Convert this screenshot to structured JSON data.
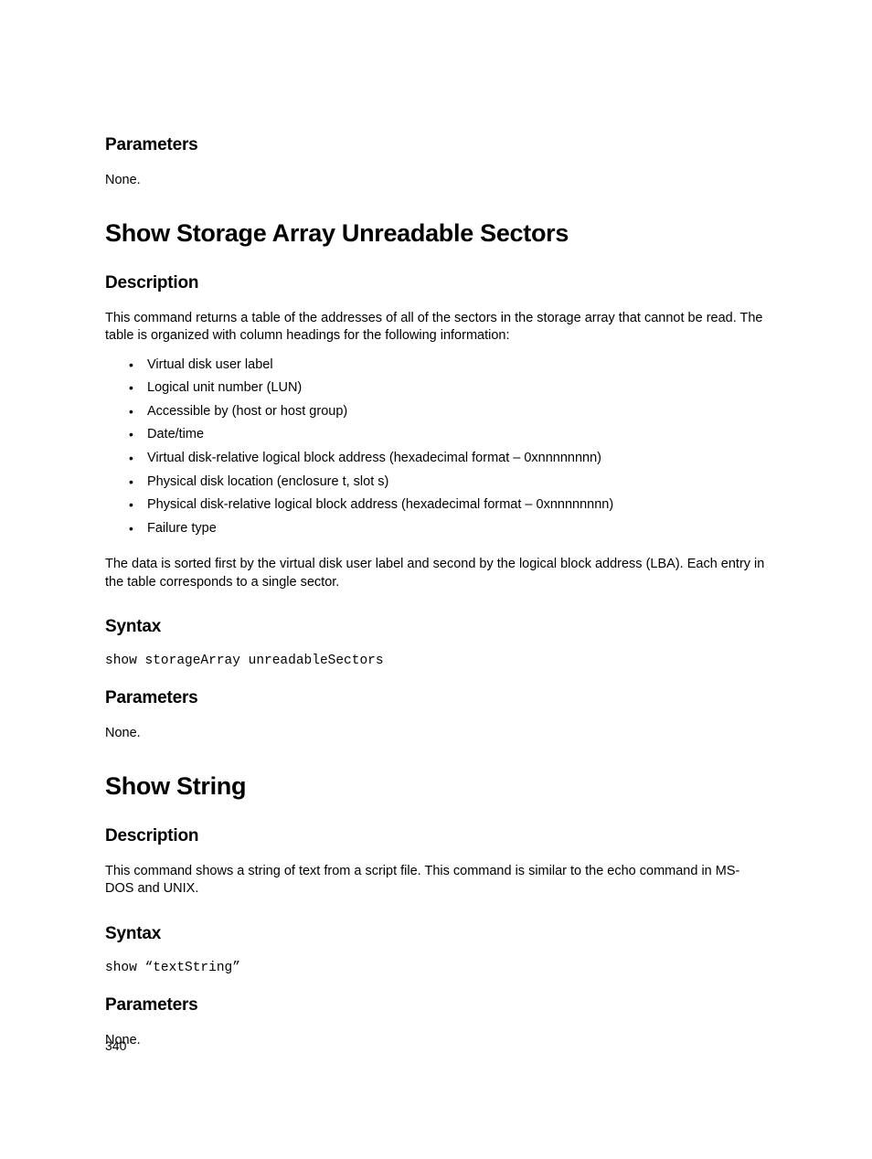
{
  "section0": {
    "parameters_heading": "Parameters",
    "parameters_body": "None."
  },
  "section1": {
    "title": "Show Storage Array Unreadable Sectors",
    "description_heading": "Description",
    "description_body": "This command returns a table of the addresses of all of the sectors in the storage array that cannot be read. The table is organized with column headings for the following information:",
    "bullets": [
      "Virtual disk user label",
      "Logical unit number (LUN)",
      "Accessible by (host or host group)",
      "Date/time",
      "Virtual disk-relative logical block address (hexadecimal format – 0xnnnnnnnn)",
      "Physical disk location (enclosure t, slot s)",
      "Physical disk-relative logical block address (hexadecimal format – 0xnnnnnnnn)",
      "Failure type"
    ],
    "description_body2": "The data is sorted first by the virtual disk user label and second by the logical block address (LBA). Each entry in the table corresponds to a single sector.",
    "syntax_heading": "Syntax",
    "syntax_code": "show storageArray unreadableSectors",
    "parameters_heading": "Parameters",
    "parameters_body": "None."
  },
  "section2": {
    "title": "Show String",
    "description_heading": "Description",
    "description_body": "This command shows a string of text from a script file. This command is similar to the echo command in MS-DOS and UNIX.",
    "syntax_heading": "Syntax",
    "syntax_code": "show “textString”",
    "parameters_heading": "Parameters",
    "parameters_body": "None."
  },
  "page_number": "340"
}
